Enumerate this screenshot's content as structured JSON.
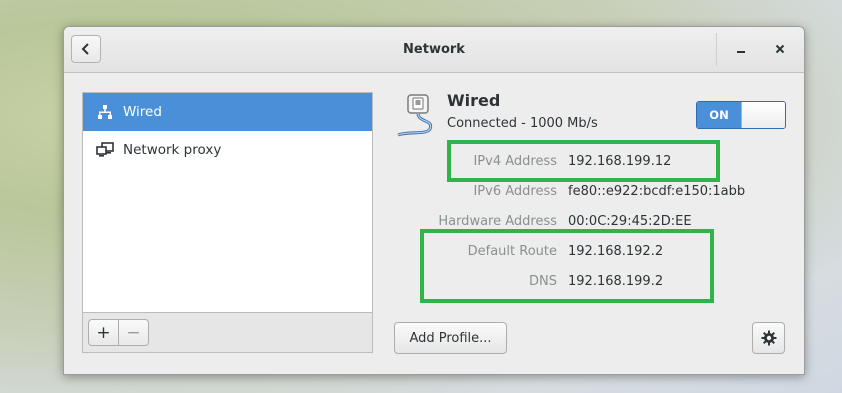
{
  "window": {
    "title": "Network"
  },
  "sidebar": {
    "items": [
      {
        "label": "Wired",
        "icon": "wired-network-icon",
        "selected": true
      },
      {
        "label": "Network proxy",
        "icon": "network-proxy-icon",
        "selected": false
      }
    ],
    "add_label": "+",
    "remove_label": "−"
  },
  "device": {
    "name": "Wired",
    "status": "Connected - 1000 Mb/s",
    "switch_label": "ON",
    "switch_on": true
  },
  "details": [
    {
      "label": "IPv4 Address",
      "value": "192.168.199.12"
    },
    {
      "label": "IPv6 Address",
      "value": "fe80::e922:bcdf:e150:1abb"
    },
    {
      "label": "Hardware Address",
      "value": "00:0C:29:45:2D:EE"
    },
    {
      "label": "Default Route",
      "value": "192.168.192.2"
    },
    {
      "label": "DNS",
      "value": "192.168.199.2"
    }
  ],
  "footer": {
    "add_profile_label": "Add Profile..."
  },
  "colors": {
    "accent": "#4a90d9",
    "highlight": "#2fb34a"
  }
}
